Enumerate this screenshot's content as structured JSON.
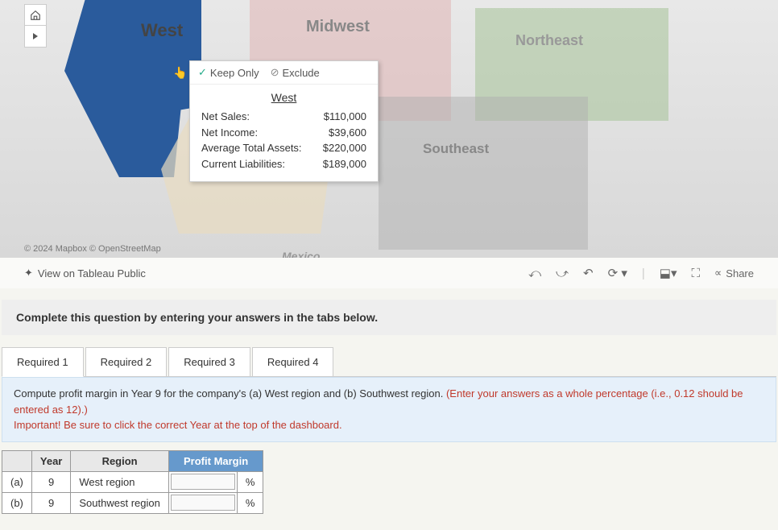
{
  "map": {
    "regions": {
      "west": "West",
      "midwest": "Midwest",
      "northeast": "Northeast",
      "southeast": "Southeast",
      "mexico": "Mexico"
    },
    "attribution": "© 2024 Mapbox © OpenStreetMap",
    "tooltip": {
      "keep_only": "Keep Only",
      "exclude": "Exclude",
      "title": "West",
      "rows": [
        {
          "label": "Net Sales:",
          "value": "$110,000"
        },
        {
          "label": "Net Income:",
          "value": "$39,600"
        },
        {
          "label": "Average Total Assets:",
          "value": "$220,000"
        },
        {
          "label": "Current Liabilities:",
          "value": "$189,000"
        }
      ]
    }
  },
  "toolbar": {
    "view_public": "View on Tableau Public",
    "share": "Share"
  },
  "instruction": "Complete this question by entering your answers in the tabs below.",
  "tabs": [
    "Required 1",
    "Required 2",
    "Required 3",
    "Required 4"
  ],
  "prompt": {
    "main": "Compute profit margin in Year 9 for the company's (a) West region and (b) Southwest region. ",
    "hint": "(Enter your answers as a whole percentage (i.e., 0.12 should be entered as 12).)",
    "important": "Important! Be sure to click the correct Year at the top of the dashboard."
  },
  "table": {
    "headers": {
      "blank": "",
      "year": "Year",
      "region": "Region",
      "profit_margin": "Profit Margin"
    },
    "rows": [
      {
        "id": "(a)",
        "year": "9",
        "region": "West region",
        "unit": "%"
      },
      {
        "id": "(b)",
        "year": "9",
        "region": "Southwest region",
        "unit": "%"
      }
    ]
  }
}
